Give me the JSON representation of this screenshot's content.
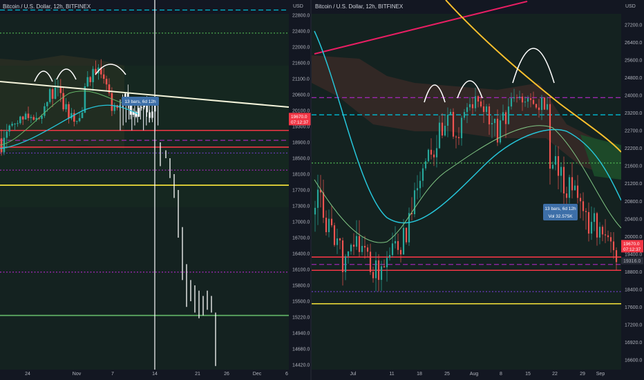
{
  "colors": {
    "background": "#131722",
    "cloud_green": "#17311f",
    "cloud_red": "#3a2a27",
    "candle_up": "#26a69a",
    "candle_down": "#ef5350",
    "price_tag": "#f23645",
    "label_box": "#3d6fa8"
  },
  "chart_data": [
    {
      "type": "candlestick",
      "title": "Bitcoin / U.S. Dollar, 12h, BITFINEX",
      "unit": "USD",
      "x_ticks": [
        "24",
        "Nov",
        "7",
        "14",
        "21",
        "26",
        "Dec",
        "6"
      ],
      "y_ticks": [
        22800.0,
        22400.0,
        22000.0,
        21600.0,
        21100.0,
        20600.0,
        20100.0,
        19300.0,
        18900.0,
        18500.0,
        18100.0,
        17700.0,
        17300.0,
        17000.0,
        16700.0,
        16400.0,
        16100.0,
        15800.0,
        15500.0,
        15220.0,
        14940.0,
        14680.0,
        14420.0
      ],
      "ylim": [
        14250,
        23150
      ],
      "price_tag": {
        "price": "19670.0",
        "countdown": "07:12:37",
        "value": 19670
      },
      "bars_label": "13 bars, 6d 12h",
      "grid": false,
      "legend": "none",
      "lines": [
        {
          "kind": "horizontal",
          "price": 22930,
          "color": "#00bcd4",
          "style": "dashed"
        },
        {
          "kind": "horizontal",
          "price": 22350,
          "color": "#4caf50",
          "style": "dotted"
        },
        {
          "kind": "horizontal",
          "price": 19200,
          "color": "#f23645",
          "style": "solid"
        },
        {
          "kind": "horizontal",
          "price": 18950,
          "color": "#9c27b0",
          "style": "dashed"
        },
        {
          "kind": "horizontal",
          "price": 18780,
          "color": "#f23645",
          "style": "solid"
        },
        {
          "kind": "horizontal",
          "price": 18630,
          "color": "#673ab7",
          "style": "dotted"
        },
        {
          "kind": "horizontal",
          "price": 18200,
          "color": "#9c27b0",
          "style": "dotted"
        },
        {
          "kind": "horizontal",
          "price": 17820,
          "color": "#ffeb3b",
          "style": "solid"
        },
        {
          "kind": "horizontal",
          "price": 16050,
          "color": "#9c27b0",
          "style": "dotted"
        },
        {
          "kind": "horizontal",
          "price": 15250,
          "color": "#66bb6a",
          "style": "solid"
        },
        {
          "kind": "vertical",
          "x_label": "14",
          "color": "#ffffff",
          "style": "solid"
        }
      ]
    },
    {
      "type": "candlestick",
      "title": "Bitcoin / U.S. Dollar, 12h, BITFINEX",
      "unit": "USD",
      "x_ticks": [
        "Jul",
        "11",
        "18",
        "25",
        "Aug",
        "8",
        "15",
        "22",
        "29",
        "Sep"
      ],
      "y_ticks": [
        27200.0,
        26400.0,
        25600.0,
        24800.0,
        24000.0,
        23200.0,
        22700.0,
        22200.0,
        21600.0,
        21200.0,
        20800.0,
        20400.0,
        20000.0,
        19400.0,
        18800.0,
        18400.0,
        17600.0,
        17200.0,
        16920.0,
        16600.0
      ],
      "ylim": [
        16400,
        27800
      ],
      "price_tag": {
        "price": "19670.0",
        "countdown": "07:12:37",
        "value": 19670
      },
      "extra_price": {
        "price": "19316.0",
        "value": 19316
      },
      "bars_label": "13 bars, 6d 12h",
      "vol_label": "Vol 32.575K",
      "grid": false,
      "legend": "none",
      "lines": [
        {
          "kind": "horizontal",
          "price": 23900,
          "color": "#9c27b0",
          "style": "dashed"
        },
        {
          "kind": "horizontal",
          "price": 23150,
          "color": "#00bcd4",
          "style": "dashed"
        },
        {
          "kind": "horizontal",
          "price": 21700,
          "color": "#4caf50",
          "style": "dotted"
        },
        {
          "kind": "horizontal",
          "price": 19300,
          "color": "#f23645",
          "style": "solid"
        },
        {
          "kind": "horizontal",
          "price": 19050,
          "color": "#9c27b0",
          "style": "dashed"
        },
        {
          "kind": "horizontal",
          "price": 18850,
          "color": "#f23645",
          "style": "solid"
        },
        {
          "kind": "horizontal",
          "price": 18300,
          "color": "#673ab7",
          "style": "dotted"
        },
        {
          "kind": "horizontal",
          "price": 17750,
          "color": "#ffeb3b",
          "style": "solid"
        }
      ]
    }
  ]
}
